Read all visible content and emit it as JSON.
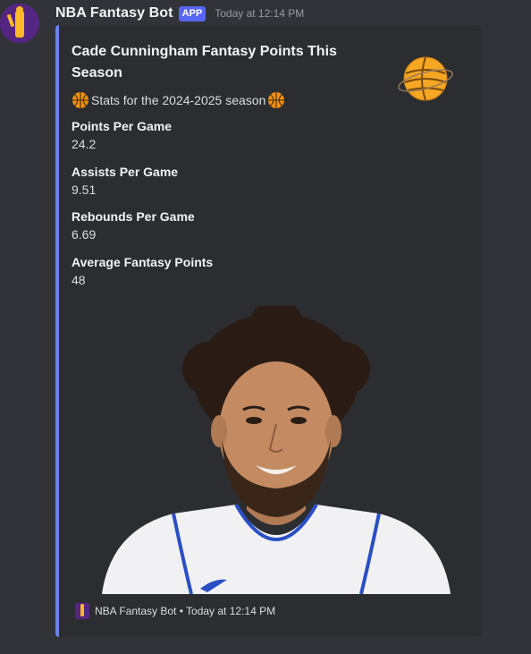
{
  "message": {
    "username": "NBA Fantasy Bot",
    "badge": "APP",
    "timestamp": "Today at 12:14 PM"
  },
  "embed": {
    "accent_color": "#6b84e6",
    "title": "Cade Cunningham Fantasy Points This Season",
    "description": "Stats for the 2024-2025 season",
    "description_icon": "basketball-emoji",
    "thumbnail_icon": "basketball-planet-icon",
    "fields": [
      {
        "name": "Points Per Game",
        "value": "24.2"
      },
      {
        "name": "Assists Per Game",
        "value": "9.51"
      },
      {
        "name": "Rebounds Per Game",
        "value": "6.69"
      },
      {
        "name": "Average Fantasy Points",
        "value": "48"
      }
    ],
    "image_subject": "player headshot",
    "footer": {
      "text": "NBA Fantasy Bot • Today at 12:14 PM"
    }
  }
}
